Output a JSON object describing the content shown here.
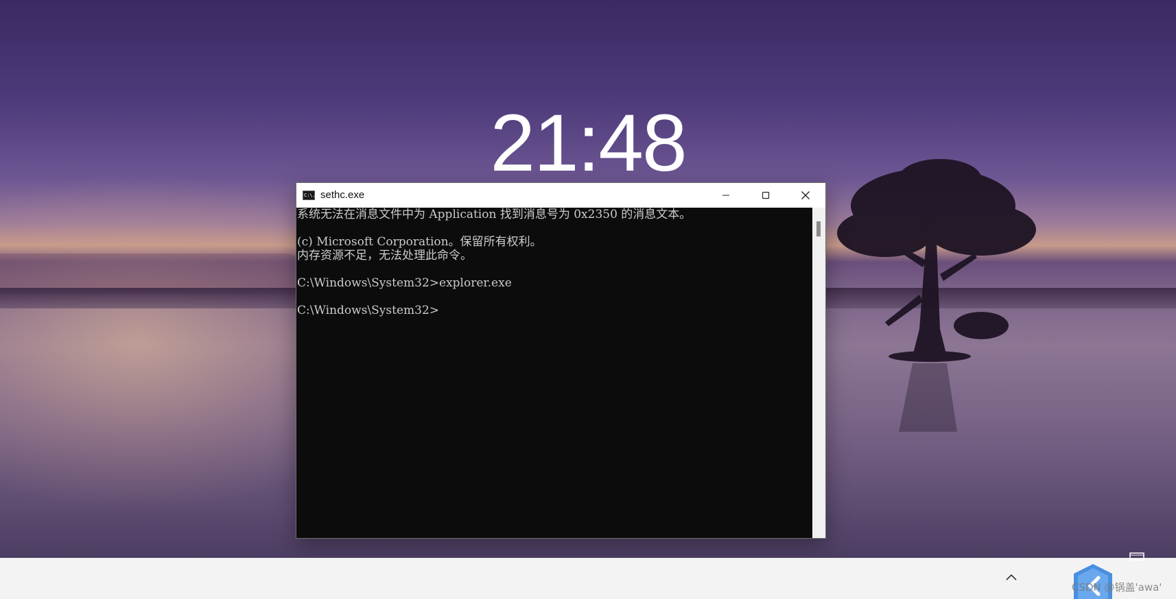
{
  "lock_screen": {
    "clock": "21:48"
  },
  "window": {
    "title": "sethc.exe",
    "icon": "console-icon",
    "icon_text": "C:\\.",
    "buttons": {
      "minimize": "minimize-icon",
      "maximize": "maximize-icon",
      "close": "close-icon"
    }
  },
  "console": {
    "lines": [
      "系统无法在消息文件中为 Application 找到消息号为 0x2350 的消息文本。",
      "",
      "(c) Microsoft Corporation。保留所有权利。",
      "内存资源不足，无法处理此命令。",
      "",
      "C:\\Windows\\System32>explorer.exe",
      "",
      "C:\\Windows\\System32>"
    ]
  },
  "taskbar": {
    "tray_chevron": "chevron-up-icon"
  },
  "watermark": "CSDN @锅盖'awa'"
}
